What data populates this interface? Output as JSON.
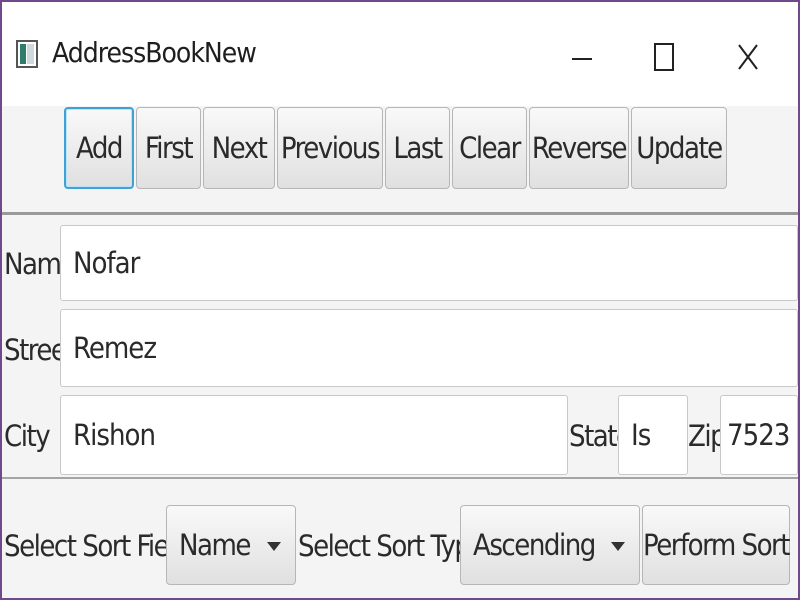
{
  "window": {
    "title": "AddressBookNew",
    "minimize_glyph": "",
    "maximize_glyph": "",
    "close_glyph": "X",
    "app_icon": "app-window-icon"
  },
  "toolbar": {
    "buttons": [
      {
        "label": "Add"
      },
      {
        "label": "First"
      },
      {
        "label": "Next"
      },
      {
        "label": "Previous"
      },
      {
        "label": "Last"
      },
      {
        "label": "Clear"
      },
      {
        "label": "Reverse"
      },
      {
        "label": "Update"
      }
    ]
  },
  "form": {
    "name_label": "Name",
    "name_value": "Nofar",
    "street_label": "Street",
    "street_value": "Remez",
    "city_label": "City",
    "city_value": "Rishon",
    "state_label": "State",
    "state_value": "Is",
    "zip_label": "Zip",
    "zip_value": "7523"
  },
  "sort": {
    "field_label": "Select Sort Field:",
    "field_value": "Name",
    "type_label": "Select Sort Type:",
    "type_value": "Ascending",
    "perform_label": "Perform Sort"
  },
  "colors": {
    "window_border": "#6e4a8c",
    "focus_ring": "#3fa2d6",
    "background": "#f4f4f4"
  }
}
